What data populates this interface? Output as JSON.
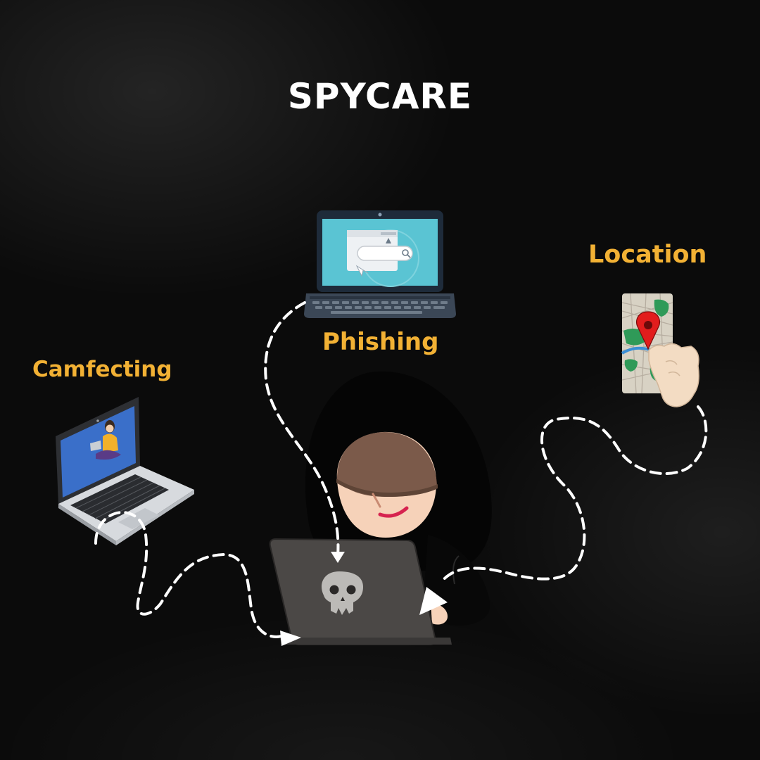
{
  "title": "SPYCARE",
  "labels": {
    "location": "Location",
    "phishing": "Phishing",
    "camfecting": "Camfecting"
  },
  "colors": {
    "background": "#0b0b0b",
    "title": "#ffffff",
    "accent": "#f2b134",
    "connector": "#ffffff"
  },
  "icons": {
    "phishing": "laptop-browser-icon",
    "location": "map-pin-phone-icon",
    "camfecting": "laptop-webcam-icon",
    "hacker": "hooded-hacker-icon",
    "skull": "skull-icon"
  }
}
